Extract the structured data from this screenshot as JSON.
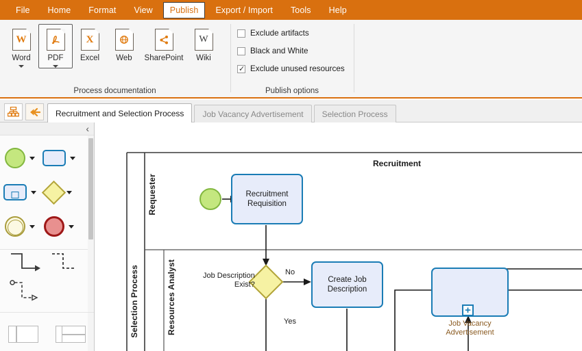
{
  "menubar": {
    "items": [
      {
        "label": "File",
        "active": false
      },
      {
        "label": "Home",
        "active": false
      },
      {
        "label": "Format",
        "active": false
      },
      {
        "label": "View",
        "active": false
      },
      {
        "label": "Publish",
        "active": true
      },
      {
        "label": "Export / Import",
        "active": false
      },
      {
        "label": "Tools",
        "active": false
      },
      {
        "label": "Help",
        "active": false
      }
    ],
    "background_color": "#d9700f",
    "text_color": "#ffffff"
  },
  "ribbon": {
    "process_documentation": {
      "group_label": "Process documentation",
      "buttons": [
        {
          "label": "Word",
          "glyph": "W",
          "icon": "word-document-icon",
          "has_dropdown": true,
          "selected": false
        },
        {
          "label": "PDF",
          "glyph": "ᴀ",
          "icon": "pdf-document-icon",
          "has_dropdown": true,
          "selected": true
        },
        {
          "label": "Excel",
          "glyph": "X",
          "icon": "excel-document-icon",
          "has_dropdown": false,
          "selected": false
        },
        {
          "label": "Web",
          "glyph": "⊕",
          "icon": "web-document-icon",
          "has_dropdown": false,
          "selected": false
        },
        {
          "label": "SharePoint",
          "glyph": "⤴",
          "icon": "sharepoint-document-icon",
          "has_dropdown": false,
          "selected": false
        },
        {
          "label": "Wiki",
          "glyph": "W",
          "icon": "wiki-document-icon",
          "has_dropdown": false,
          "selected": false
        }
      ]
    },
    "publish_options": {
      "group_label": "Publish options",
      "checkboxes": [
        {
          "label": "Exclude artifacts",
          "checked": false
        },
        {
          "label": "Black and White",
          "checked": false
        },
        {
          "label": "Exclude unused resources",
          "checked": true
        }
      ]
    }
  },
  "tabstrip": {
    "tools": [
      {
        "name": "process-hierarchy-icon",
        "label": ""
      },
      {
        "name": "back-arrow-icon",
        "label": ""
      }
    ],
    "tabs": [
      {
        "label": "Recruitment and Selection Process",
        "active": true
      },
      {
        "label": "Job Vacancy Advertisement",
        "active": false
      },
      {
        "label": "Selection Process",
        "active": false
      }
    ]
  },
  "palette": {
    "collapse_chevron": "‹",
    "shapes_row1": [
      {
        "name": "start-event-shape",
        "has_dropdown": true
      },
      {
        "name": "task-shape",
        "has_dropdown": true
      }
    ],
    "shapes_row2": [
      {
        "name": "subprocess-shape",
        "has_dropdown": true
      },
      {
        "name": "gateway-shape",
        "has_dropdown": true
      }
    ],
    "shapes_row3": [
      {
        "name": "intermediate-event-shape",
        "has_dropdown": true
      },
      {
        "name": "end-event-shape",
        "has_dropdown": true
      }
    ],
    "connectors": [
      {
        "name": "sequence-flow-connector"
      },
      {
        "name": "association-connector"
      },
      {
        "name": "message-flow-connector"
      }
    ],
    "containers": [
      {
        "name": "pool-shape"
      },
      {
        "name": "lane-set-shape"
      }
    ],
    "colors": {
      "start_event_fill": "#c4e77f",
      "start_event_stroke": "#82b73f",
      "task_fill": "#e7ecfa",
      "task_stroke": "#1a7cb5",
      "gateway_fill": "#f6f2a3",
      "gateway_stroke": "#b2a43a",
      "intermediate_fill": "#fcf9e2",
      "intermediate_stroke": "#a99c3b",
      "end_event_fill": "#e8908f",
      "end_event_stroke": "#9e1717"
    }
  },
  "diagram": {
    "pool_title": "Recruitment",
    "pool_label": "Selection Process",
    "lanes": [
      {
        "label": "Requester"
      },
      {
        "label": "Resources Analyst"
      }
    ],
    "nodes": [
      {
        "name": "start-event",
        "type": "start-event",
        "label": ""
      },
      {
        "name": "task-recruitment-requisition",
        "type": "task",
        "label": "Recruitment\nRequisition"
      },
      {
        "name": "gateway-job-description-exist",
        "type": "gateway",
        "label": "Job Description\nExist?"
      },
      {
        "name": "task-create-job-description",
        "type": "task",
        "label": "Create Job\nDescription"
      },
      {
        "name": "subprocess-job-vacancy-advertisement",
        "type": "subprocess",
        "label": "Job Vacancy\nAdvertisement",
        "marker": "+"
      }
    ],
    "flow_labels": [
      {
        "text": "No"
      },
      {
        "text": "Yes"
      }
    ]
  }
}
